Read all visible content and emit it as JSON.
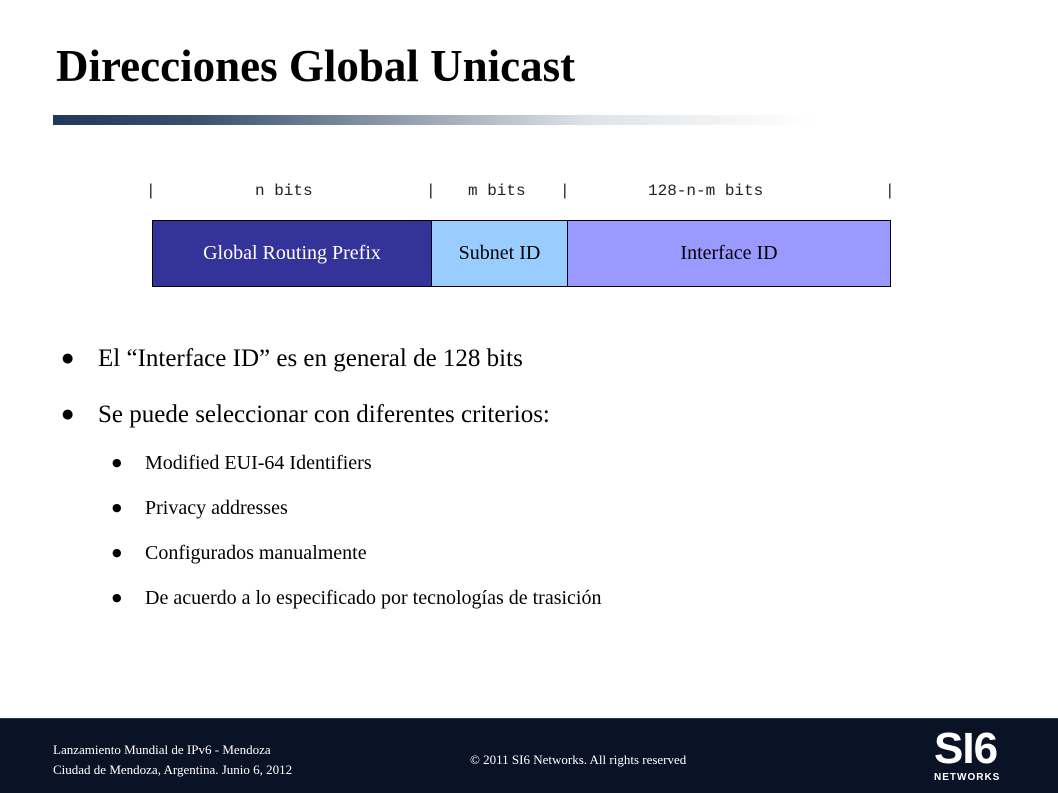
{
  "title": "Direcciones Global Unicast",
  "diagram": {
    "bit_header": {
      "sep": "|",
      "n_bits": "n bits",
      "m_bits": "m bits",
      "rest_bits": "128-n-m bits"
    },
    "fields": [
      {
        "label": "Global Routing Prefix",
        "color": "#333399"
      },
      {
        "label": "Subnet ID",
        "color": "#99ccff"
      },
      {
        "label": "Interface ID",
        "color": "#9999ff"
      }
    ]
  },
  "bullets": [
    {
      "text": "El “Interface ID” es en general de 128 bits"
    },
    {
      "text": "Se puede seleccionar con diferentes criterios:"
    }
  ],
  "sub_bullets": [
    {
      "text": "Modified EUI-64 Identifiers"
    },
    {
      "text": "Privacy addresses"
    },
    {
      "text": "Configurados manualmente"
    },
    {
      "text": "De acuerdo a lo especificado por tecnologías de trasición"
    }
  ],
  "bullet_glyph": "●",
  "footer": {
    "line1": "Lanzamiento Mundial de IPv6 - Mendoza",
    "line2": "Ciudad de Mendoza, Argentina. Junio 6, 2012",
    "copyright": "© 2011 SI6 Networks. All rights reserved",
    "logo_main": "SI6",
    "logo_sub": "NETWORKS",
    "background": "#0a1226"
  }
}
